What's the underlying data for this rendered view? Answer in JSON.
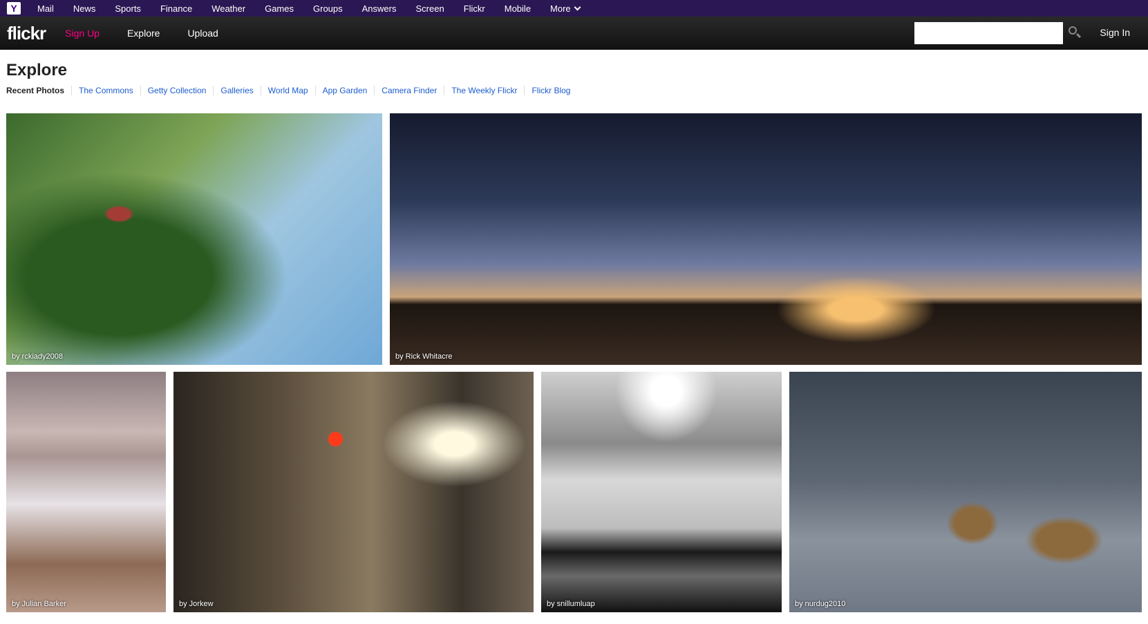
{
  "ybar": {
    "logo": "Y",
    "links": [
      "Mail",
      "News",
      "Sports",
      "Finance",
      "Weather",
      "Games",
      "Groups",
      "Answers",
      "Screen",
      "Flickr",
      "Mobile",
      "More"
    ]
  },
  "fbar": {
    "logo": "flickr",
    "signup": "Sign Up",
    "explore": "Explore",
    "upload": "Upload",
    "search_placeholder": "",
    "signin": "Sign In"
  },
  "page": {
    "title": "Explore",
    "subnav": [
      "Recent Photos",
      "The Commons",
      "Getty Collection",
      "Galleries",
      "World Map",
      "App Garden",
      "Camera Finder",
      "The Weekly Flickr",
      "Flickr Blog"
    ]
  },
  "photos": [
    {
      "by": "by rckiady2008"
    },
    {
      "by": "by Rick Whitacre"
    },
    {
      "by": "by Julian Barker"
    },
    {
      "by": "by Jorkew"
    },
    {
      "by": "by snillumluap"
    },
    {
      "by": "by nurdug2010"
    }
  ]
}
